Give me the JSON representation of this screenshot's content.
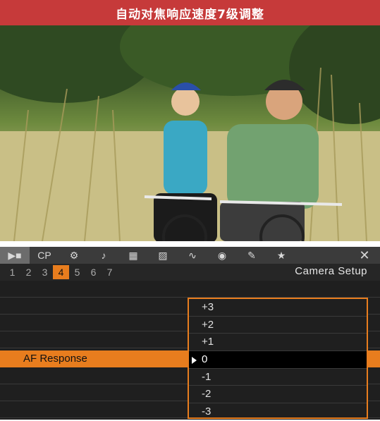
{
  "banner": {
    "title": "自动对焦响应速度7级调整"
  },
  "menu": {
    "tabs": [
      {
        "name": "camera-icon",
        "glyph": "▶■"
      },
      {
        "name": "cp-icon",
        "glyph": "CP"
      },
      {
        "name": "camera-settings-icon",
        "glyph": "⚙"
      },
      {
        "name": "audio-icon",
        "glyph": "♪"
      },
      {
        "name": "video-setup-icon",
        "glyph": "▦"
      },
      {
        "name": "lcd-icon",
        "glyph": "▨"
      },
      {
        "name": "tc-icon",
        "glyph": "∿"
      },
      {
        "name": "recording-icon",
        "glyph": "◉"
      },
      {
        "name": "wrench-icon",
        "glyph": "✎"
      },
      {
        "name": "star-icon",
        "glyph": "★"
      },
      {
        "name": "close-icon",
        "glyph": "✕"
      }
    ],
    "pages": [
      "1",
      "2",
      "3",
      "4",
      "5",
      "6",
      "7"
    ],
    "active_page": "4",
    "page_title": "Camera Setup",
    "selected_item": "AF Response",
    "options": [
      "+3",
      "+2",
      "+1",
      "0",
      "-1",
      "-2",
      "-3"
    ],
    "selected_option": "0",
    "accent_color": "#e87d1e"
  }
}
